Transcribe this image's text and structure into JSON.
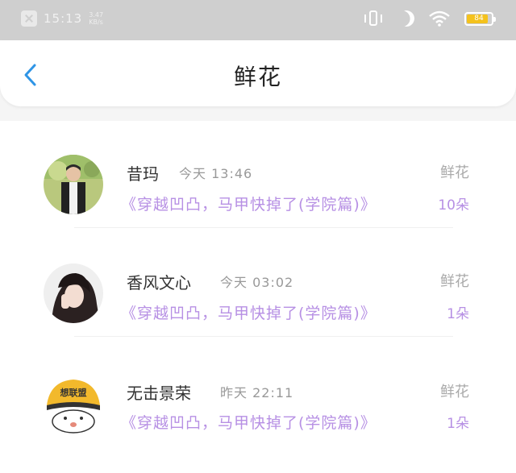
{
  "status_bar": {
    "time": "15:13",
    "net_speed": "3.47 KB/s",
    "battery_level": "84",
    "icons": [
      "close-icon",
      "vibrate-icon",
      "moon-icon",
      "wifi-icon",
      "battery-icon"
    ]
  },
  "header": {
    "back_icon": "chevron-left-icon",
    "title": "鲜花"
  },
  "colors": {
    "accent_blue": "#2f95e6",
    "book_purple": "#b790e4",
    "battery_yellow": "#f4c21d"
  },
  "items": [
    {
      "name": "昔玛",
      "time": "今天 13:46",
      "book": "《穿越凹凸，马甲快掉了(学院篇)》",
      "gift": "鲜花",
      "count": "10朵"
    },
    {
      "name": "香风文心",
      "time": "今天 03:02",
      "book": "《穿越凹凸，马甲快掉了(学院篇)》",
      "gift": "鲜花",
      "count": "1朵"
    },
    {
      "name": "无击景荣",
      "time": "昨天 22:11",
      "book": "《穿越凹凸，马甲快掉了(学院篇)》",
      "gift": "鲜花",
      "count": "1朵",
      "avatar_text": "想联盟"
    }
  ]
}
